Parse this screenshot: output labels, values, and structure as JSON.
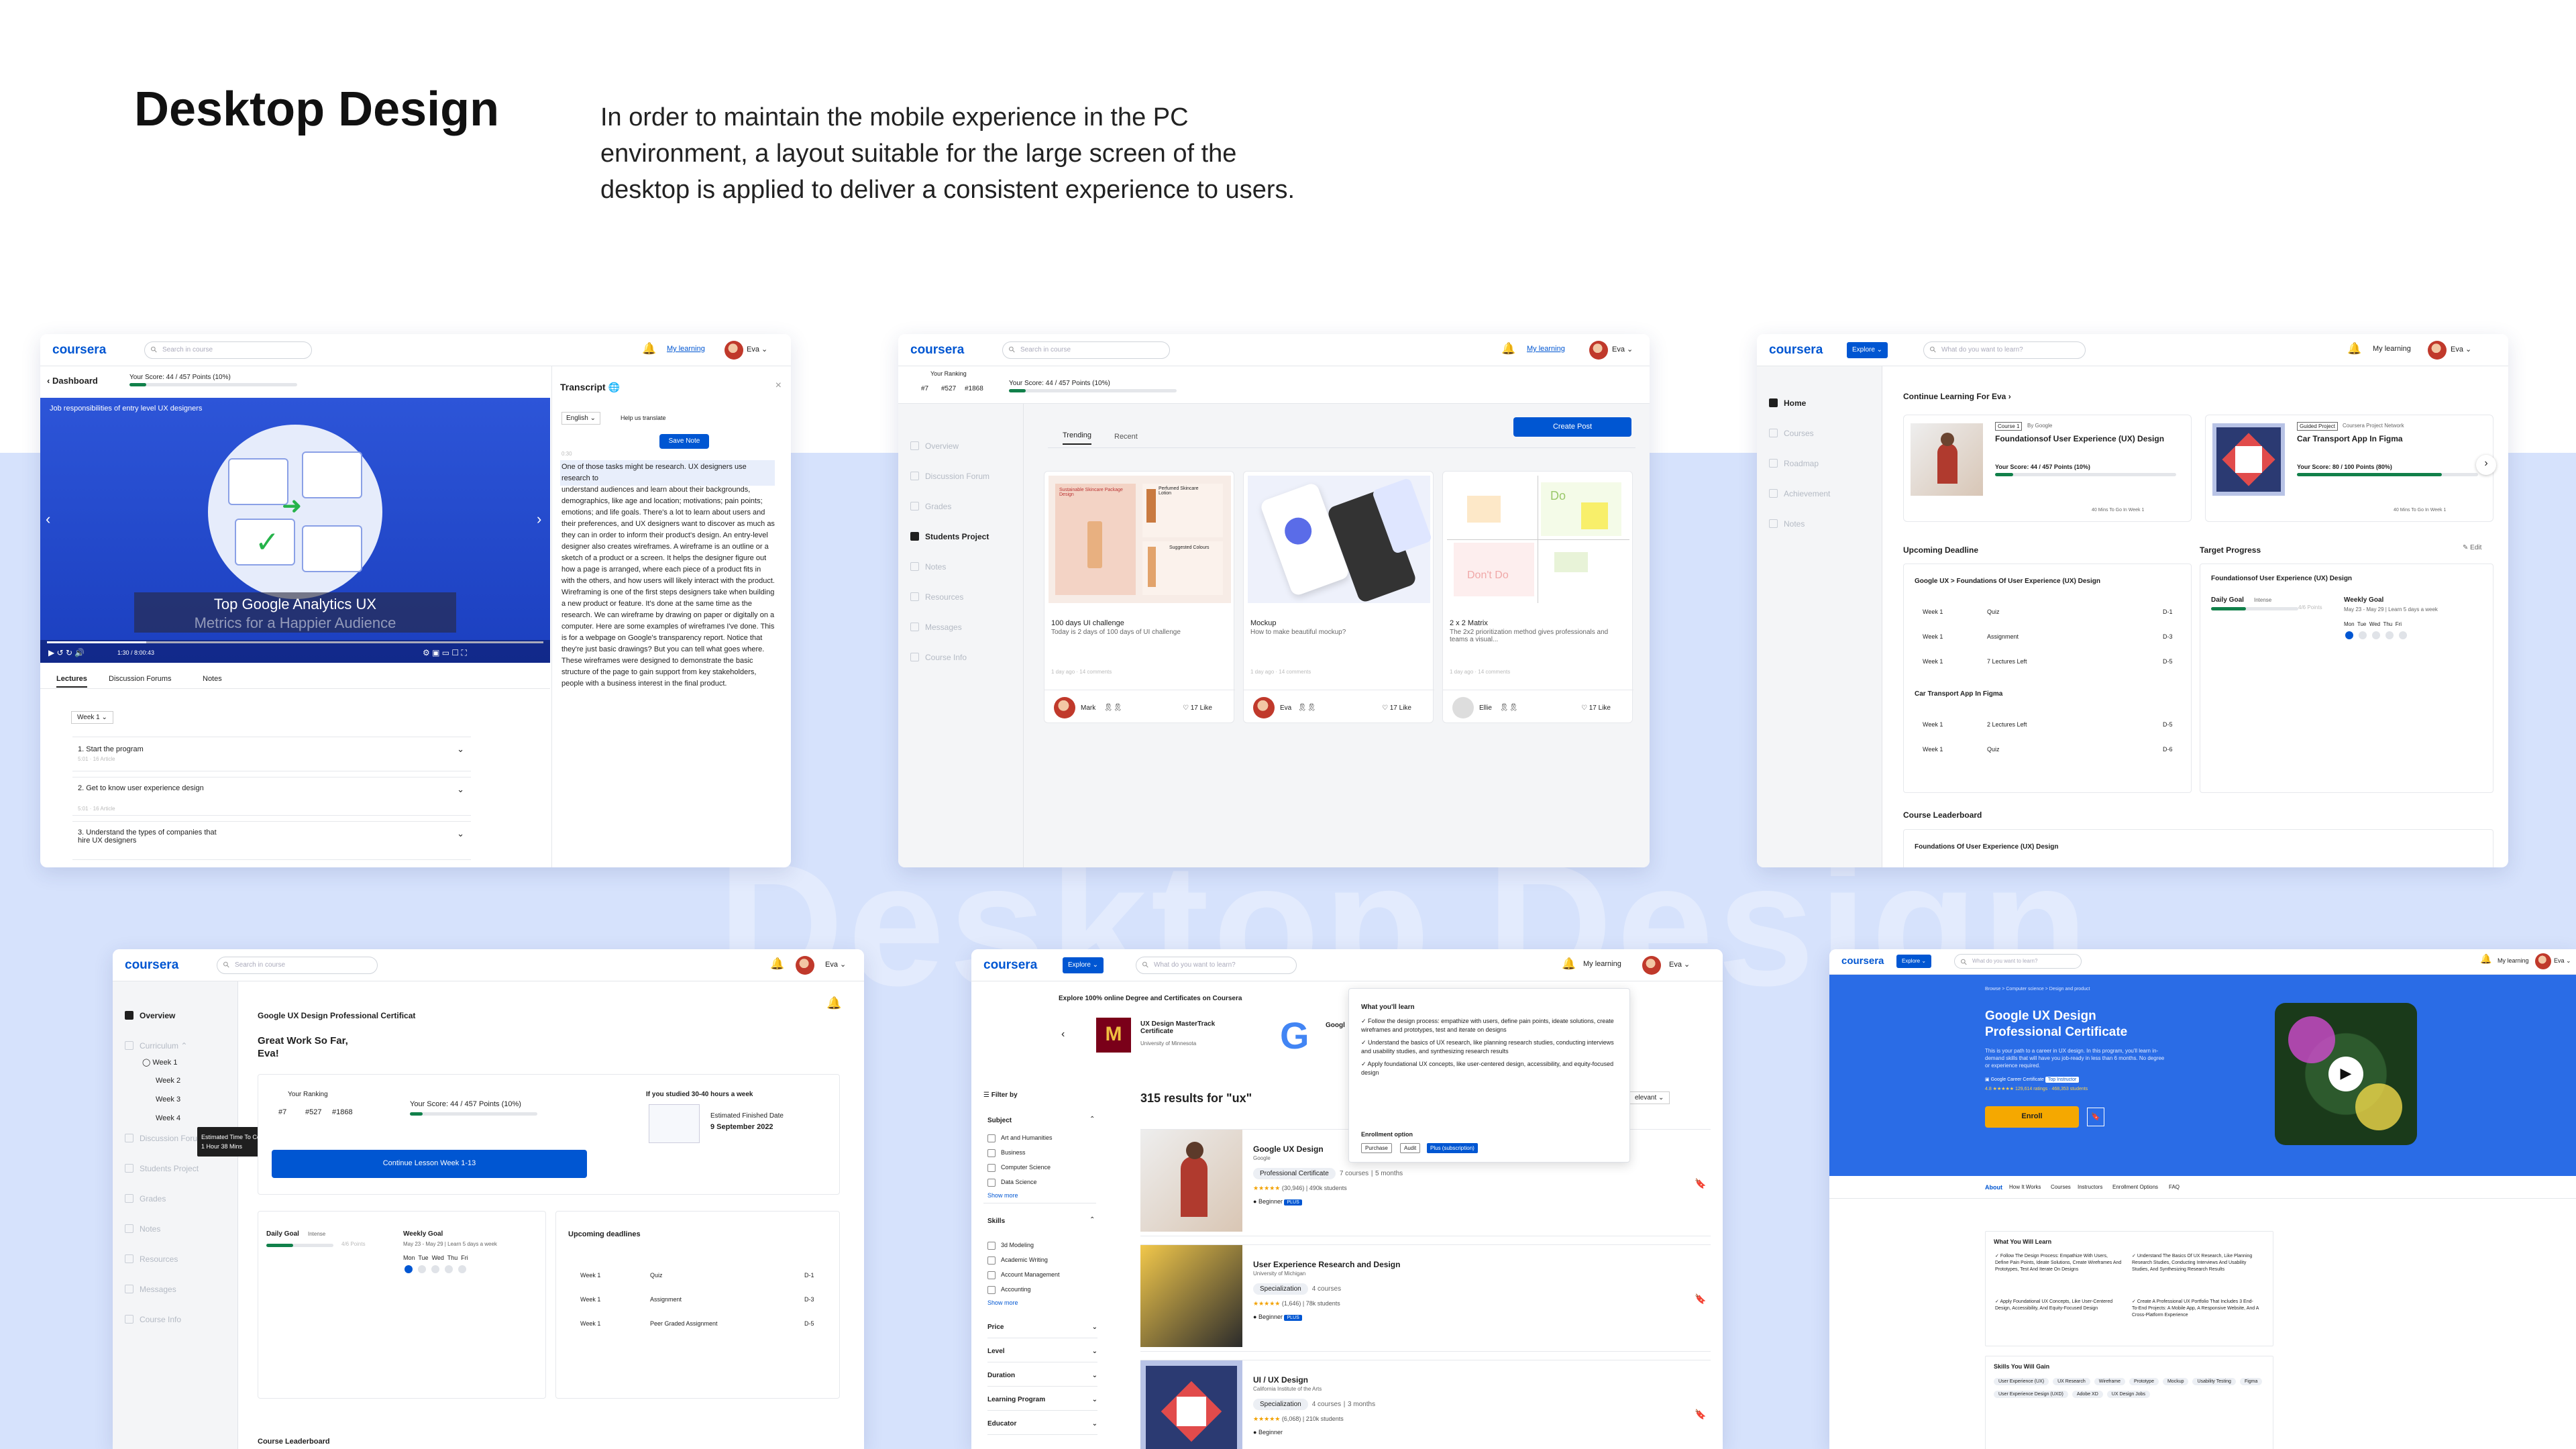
{
  "header": {
    "title": "Desktop Design",
    "description": "In order to maintain the mobile experience in the PC environment, a layout suitable for the large screen of the desktop is applied to deliver a consistent experience to users.",
    "watermark": "Desktop Design"
  },
  "common": {
    "logo": "coursera",
    "search": "Search in course",
    "search2": "What do you want to learn?",
    "my_learning": "My learning",
    "user": "Eva",
    "explore": "Explore",
    "score": "Your Score: 44 / 457 Points (10%)",
    "score_pct": 10
  },
  "video": {
    "back": "Dashboard",
    "banner": "Job responsibilities of entry level UX designers",
    "caption1": "Top Google Analytics UX",
    "caption2": "Metrics for a Happier Audience",
    "time": "1:30 / 8:00:43",
    "tabs": [
      "Lectures",
      "Discussion Forums",
      "Notes"
    ],
    "week": "Week 1",
    "lessons": [
      {
        "t": "1. Start the program",
        "m": "5:01 · 16 Article"
      },
      {
        "t": "2. Get to know user experience design",
        "m": "5:01 · 16 Article"
      },
      {
        "t": "3. Understand the types of companies that hire UX designers",
        "m": ""
      }
    ],
    "transcript_title": "Transcript",
    "lang": "English",
    "help": "Help us translate",
    "save_note": "Save Note",
    "ts": "0:30",
    "highlight": "One of those tasks might be research. UX designers use research to",
    "body": "understand audiences and learn about their backgrounds, demographics, like age and location; motivations; pain points; emotions; and life goals. There's a lot to learn about users and their preferences, and UX designers want to discover as much as they can in order to inform their product's design. An entry-level designer also creates wireframes. A wireframe is an outline or a sketch of a product or a screen. It helps the designer figure out how a page is arranged, where each piece of a product fits in with the others, and how users will likely interact with the product. Wireframing is one of the first steps designers take when building a new product or feature. It's done at the same time as the research. We can wireframe by drawing on paper or digitally on a computer. Here are some examples of wireframes I've done. This is for a webpage on Google's transparency report. Notice that they're just basic drawings? But you can tell what goes where. These wireframes were designed to demonstrate the basic structure of the page to gain support from key stakeholders, people with a business interest in the final product."
  },
  "forum": {
    "ranking": "Your Ranking",
    "rank": [
      "#7",
      "#527",
      "#1868"
    ],
    "rank_sub": [
      "Students Rank",
      "Rank",
      "Worldwide"
    ],
    "nav": [
      "Overview",
      "Discussion Forum",
      "Grades",
      "Students Project",
      "Notes",
      "Resources",
      "Messages",
      "Course Info"
    ],
    "tabs": [
      "Trending",
      "Recent"
    ],
    "create": "Create Post",
    "posts": [
      {
        "title": "100 days UI challenge",
        "desc": "Today is 2 days of 100 days of UI challenge",
        "meta": "1 day ago  ·  14 comments",
        "user": "Mark",
        "likes": "17 Like"
      },
      {
        "title": "Mockup",
        "desc": "How to make beautiful mockup?",
        "meta": "1 day ago  ·  14 comments",
        "user": "Eva",
        "likes": "17 Like"
      },
      {
        "title": "2 x 2 Matrix",
        "desc": "The 2x2 prioritization method gives professionals and teams a visual...",
        "meta": "1 day ago  ·  14 comments",
        "user": "Ellie",
        "likes": "17 Like"
      }
    ],
    "bottle_text": "Sustainable Skincare Package Design",
    "bottle_text2": "Perfumed Skincare Lotion",
    "suggested": "Suggested Colours",
    "doo": "Do",
    "dont": "Don't Do"
  },
  "home": {
    "nav": [
      "Home",
      "Courses",
      "Roadmap",
      "Achievement",
      "Notes"
    ],
    "continue": "Continue Learning For Eva",
    "c1": {
      "badge": "Course 1",
      "by": "By Google",
      "title": "Foundationsof User Experience (UX) Design",
      "score": "Your Score: 44 / 457 Points (10%)",
      "pct": 10,
      "foot1": "40 Mins To Go In",
      "foot2": "Week 1"
    },
    "c2": {
      "badge": "Guided Project",
      "by": "Coursera Project Network",
      "title": "Car Transport App In Figma",
      "score": "Your Score: 80 / 100 Points (80%)",
      "pct": 80,
      "foot1": "40 Mins To Go In",
      "foot2": "Week 1"
    },
    "deadline": "Upcoming Deadline",
    "dl1": "Google UX > Foundations Of User Experience (UX) Design",
    "dl1_rows": [
      {
        "w": "Week 1",
        "t": "Quiz",
        "d": "D-1"
      },
      {
        "w": "Week 1",
        "t": "Assignment",
        "d": "D-3"
      },
      {
        "w": "Week 1",
        "t": "7 Lectures Left",
        "d": "D-5"
      }
    ],
    "dl2": "Car Transport App In Figma",
    "dl2_rows": [
      {
        "w": "Week 1",
        "t": "2 Lectures Left",
        "d": "D-5"
      },
      {
        "w": "Week 1",
        "t": "Quiz",
        "d": "D-6"
      }
    ],
    "target": "Target Progress",
    "edit": "Edit",
    "tp_course": "Foundationsof User Experience (UX) Design",
    "daily": "Daily Goal",
    "intense": "Intense",
    "pts": "4/6 Points",
    "weekly": "Weekly Goal",
    "weekly_sub": "May 23 - May 29 | Learn 5 days a week",
    "days": [
      "Mon",
      "Tue",
      "Wed",
      "Thu",
      "Fri"
    ],
    "leader": "Course Leaderboard",
    "leader_course": "Foundations Of User Experience (UX) Design"
  },
  "overview": {
    "nav": [
      "Overview",
      "Curriculum",
      "Week 1",
      "Week 2",
      "Week 3",
      "Week 4",
      "Discussion Forum",
      "Students Project",
      "Grades",
      "Notes",
      "Resources",
      "Messages",
      "Course Info"
    ],
    "course": "Google UX Design Professional Certificat",
    "great": "Great Work So Far,",
    "name": "Eva!",
    "ranking": "Your Ranking",
    "rank": [
      "#7",
      "#527",
      "#1868"
    ],
    "score": "Your Score: 44 / 457 Points (10%)",
    "studied": "If you studied 30-40 hours a week",
    "est": "Estimated Finished Date",
    "date": "9 September 2022",
    "cont": "Continue Lesson Week 1-13",
    "tip1": "Estimated Time To Complete",
    "tip2": "1 Hour 38 Mins",
    "daily": "Daily Goal",
    "intense": "Intense",
    "pts": "4/6 Points",
    "weekly": "Weekly Goal",
    "weekly_sub": "May 23 - May 29 | Learn 5 days a week",
    "days": [
      "Mon",
      "Tue",
      "Wed",
      "Thu",
      "Fri"
    ],
    "upcoming": "Upcoming deadlines",
    "rows": [
      {
        "w": "Week 1",
        "t": "Quiz",
        "d": "D-1"
      },
      {
        "w": "Week 1",
        "t": "Assignment",
        "d": "D-3"
      },
      {
        "w": "Week 1",
        "t": "Peer Graded Assignment",
        "d": "D-5"
      }
    ],
    "leader": "Course Leaderboard"
  },
  "search": {
    "promo": "Explore 100% online Degree and Certificates on Coursera",
    "p1": "UX Design MasterTrack Certificate",
    "p1s": "University of Minnesota",
    "p2": "Googl",
    "filter": "Filter by",
    "subject": "Subject",
    "subjects": [
      "Art and Humanities",
      "Business",
      "Computer Science",
      "Data Science"
    ],
    "show": "Show more",
    "skills": "Skills",
    "skills_list": [
      "3d Modeling",
      "Academic Writing",
      "Account Management",
      "Accounting"
    ],
    "more": [
      "Price",
      "Level",
      "Duration",
      "Learning Program",
      "Educator"
    ],
    "results": "315 results for \"ux\"",
    "relevant": "elevant",
    "items": [
      {
        "t": "Google UX Design",
        "o": "Google",
        "tag": "Professional Certificate",
        "c": "7 courses",
        "m": "5 months",
        "r": "(30,946)",
        "st": "490k students",
        "l": "Beginner"
      },
      {
        "t": "User Experience Research and Design",
        "o": "University of Michigan",
        "tag": "Specialization",
        "c": "4 courses",
        "m": "",
        "r": "(1,646)",
        "st": "78k students",
        "l": "Beginner"
      },
      {
        "t": "UI / UX Design",
        "o": "California Institute of the Arts",
        "tag": "Specialization",
        "c": "4 courses",
        "m": "3 months",
        "r": "(6,068)",
        "st": "210k students",
        "l": "Beginner"
      }
    ],
    "plus": "PLUS",
    "pop_title": "What you'll learn",
    "pop": [
      "Follow the design process: empathize with users, define pain points, ideate solutions, create wireframes and prototypes, test and iterate on designs",
      "Understand the basics of UX research, like planning research studies, conducting interviews and usability studies, and synthesizing research results",
      "Apply foundational UX concepts, like user-centered design, accessibility, and equity-focused design"
    ],
    "enroll": "Enrollment option",
    "opts": [
      "Purchase",
      "Audit",
      "Plus (subscription)"
    ]
  },
  "cert": {
    "crumb": "Browse  >  Computer science  >  Design and product",
    "title": "Google UX Design Professional Certificate",
    "text": "This is your path to a career in UX design. In this program, you'll learn in-demand skills that will have you job-ready in less than 6 months. No degree or experience required.",
    "badge": "Google Career Certificate",
    "top": "Top Instructor",
    "rating": "4.8 ★★★★★ 129,614 ratings · 468,353 students",
    "enroll": "Enroll",
    "tabs": [
      "About",
      "How It Works",
      "Courses",
      "Instructors",
      "Enrollment Options",
      "FAQ"
    ],
    "learn": "What You Will Learn",
    "learn_items": [
      "Follow The Design Process: Empathize With Users, Define Pain Points, Ideate Solutions, Create Wireframes And Prototypes, Test And Iterate On Designs",
      "Understand The Basics Of UX Research, Like Planning Research Studies, Conducting Interviews And Usability Studies, And Synthesizing Research Results",
      "Apply Foundational UX Concepts, Like User-Centered Design, Accessibility, And Equity-Focused Design",
      "Create A Professional UX Portfolio That Includes 3 End-To-End Projects: A Mobile App, A Responsive Website, And A Cross-Platform Experience"
    ],
    "skills": "Skills You Will Gain",
    "skill_tags": [
      "User Experience (UX)",
      "UX Research",
      "Wireframe",
      "Prototype",
      "Mockup",
      "Usability Testing",
      "Figma",
      "User Experience Design (UXD)",
      "Adobe XD",
      "UX Design Jobs"
    ]
  }
}
